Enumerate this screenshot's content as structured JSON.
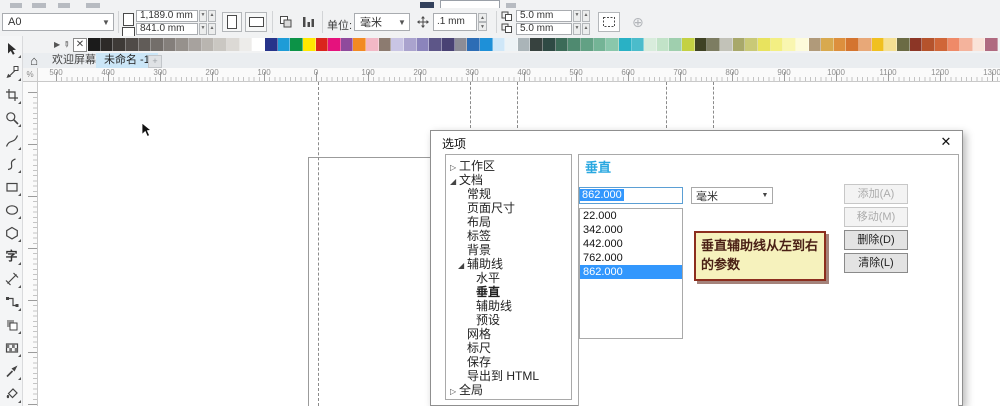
{
  "toolbar": {
    "paper_size": "A0",
    "width_value": "1,189.0 mm",
    "height_value": "841.0 mm",
    "units_label": "单位:",
    "units_value": "毫米",
    "nudge_value": ".1 mm",
    "duplicate_x": "5.0 mm",
    "duplicate_y": "5.0 mm"
  },
  "palette": {
    "colors": [
      "#1b1b1b",
      "#2d2a28",
      "#3e3a37",
      "#504b48",
      "#615c58",
      "#736e6a",
      "#847f7b",
      "#96918c",
      "#a7a29e",
      "#b9b5b0",
      "#cac7c2",
      "#dcd9d5",
      "#edecea",
      "#ffffff",
      "#27348b",
      "#1e9cd7",
      "#0c9347",
      "#ffe800",
      "#da251d",
      "#e5127d",
      "#8f4a9c",
      "#f28a23",
      "#f2b8c6",
      "#8c7b70",
      "#c9c5e4",
      "#aaa3ce",
      "#8b84bc",
      "#5d5688",
      "#494274",
      "#8c8c96",
      "#2d6db5",
      "#1e90d8",
      "#cfe7f8",
      "#edf3f6",
      "#aab4b8",
      "#37423f",
      "#2f4a44",
      "#3c6b58",
      "#4f8a70",
      "#62a184",
      "#74b496",
      "#8ac7ab",
      "#29b1c5",
      "#4bbccb",
      "#d8ecdc",
      "#c2e3c8",
      "#9fcfae",
      "#c3d143",
      "#3f4224",
      "#7d7d62",
      "#c2c2b8",
      "#a8a86a",
      "#c9c977",
      "#e8e35e",
      "#f3ef83",
      "#f9f6b0",
      "#fdfbda",
      "#b09a7a",
      "#d8a94e",
      "#dd8f3d",
      "#d4742f",
      "#e8a878",
      "#f0c020",
      "#f5e093",
      "#6b6b44",
      "#8c3626",
      "#b5532c",
      "#d06638",
      "#ef8a68",
      "#f4b39c",
      "#fae3d8",
      "#b06a80"
    ]
  },
  "tabs": {
    "welcome": "欢迎屏幕",
    "document": "未命名 -1",
    "add": "+"
  },
  "ruler": {
    "labels": [
      "500",
      "400",
      "300",
      "200",
      "100",
      "0",
      "100",
      "200",
      "300",
      "400",
      "500",
      "600",
      "700",
      "800",
      "900",
      "1000",
      "1100",
      "1200",
      "1300"
    ]
  },
  "toolbox": {
    "tools": [
      {
        "name": "pick-tool"
      },
      {
        "name": "shape-tool"
      },
      {
        "name": "crop-tool"
      },
      {
        "name": "zoom-tool"
      },
      {
        "name": "freehand-tool"
      },
      {
        "name": "bspline-tool"
      },
      {
        "name": "rectangle-tool"
      },
      {
        "name": "ellipse-tool"
      },
      {
        "name": "polygon-tool"
      },
      {
        "name": "text-tool",
        "glyph": "字"
      },
      {
        "name": "dimension-tool"
      },
      {
        "name": "connector-tool"
      },
      {
        "name": "drop-shadow-tool"
      },
      {
        "name": "transparency-tool"
      },
      {
        "name": "eyedropper-tool"
      },
      {
        "name": "fill-tool"
      }
    ]
  },
  "dialog": {
    "title": "选项",
    "close": "✕",
    "tree": [
      {
        "label": "工作区",
        "level": 0,
        "arrow": "collapsed"
      },
      {
        "label": "文档",
        "level": 0,
        "arrow": "expanded"
      },
      {
        "label": "常规",
        "level": 1
      },
      {
        "label": "页面尺寸",
        "level": 1
      },
      {
        "label": "布局",
        "level": 1
      },
      {
        "label": "标签",
        "level": 1
      },
      {
        "label": "背景",
        "level": 1
      },
      {
        "label": "辅助线",
        "level": 1,
        "arrow": "expanded"
      },
      {
        "label": "水平",
        "level": 2
      },
      {
        "label": "垂直",
        "level": 2,
        "selected": true
      },
      {
        "label": "辅助线",
        "level": 2
      },
      {
        "label": "预设",
        "level": 2
      },
      {
        "label": "网格",
        "level": 1
      },
      {
        "label": "标尺",
        "level": 1
      },
      {
        "label": "保存",
        "level": 1
      },
      {
        "label": "导出到 HTML",
        "level": 1
      },
      {
        "label": "全局",
        "level": 0,
        "arrow": "collapsed"
      }
    ],
    "panel": {
      "heading": "垂直",
      "input_value": "862.000",
      "unit_value": "毫米",
      "list": [
        "22.000",
        "342.000",
        "442.000",
        "762.000",
        "862.000"
      ],
      "selected_index": 4,
      "buttons": [
        {
          "label": "添加(A)",
          "enabled": false
        },
        {
          "label": "移动(M)",
          "enabled": false
        },
        {
          "label": "删除(D)",
          "enabled": true
        },
        {
          "label": "清除(L)",
          "enabled": true
        }
      ]
    },
    "annotation": "垂直辅助线从左到右的参数"
  },
  "colors": {
    "selection_blue": "#3297fd",
    "heading_blue": "#29a8e0",
    "annotation_bg": "#f6f2bd",
    "annotation_border": "#8c2e1e",
    "active_tab_bg": "#cbe6f7"
  }
}
